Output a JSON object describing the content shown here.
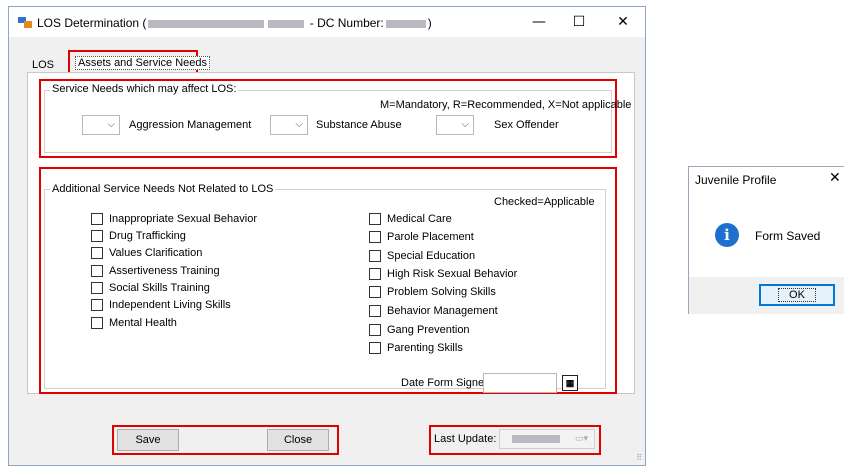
{
  "window": {
    "title_prefix": "LOS Determination (",
    "title_middle": "- DC Number:",
    "title_suffix": ")",
    "minimize": "—",
    "maximize": "☐",
    "close": "✕"
  },
  "tabs": {
    "los": "LOS",
    "assets": "Assets and Service Needs"
  },
  "service_needs": {
    "group_title": "Service Needs which may affect LOS:",
    "legend": "M=Mandatory, R=Recommended, X=Not applicable",
    "items": [
      "Aggression Management",
      "Substance Abuse",
      "Sex Offender"
    ]
  },
  "additional": {
    "group_title": "Additional Service Needs Not Related to LOS",
    "legend": "Checked=Applicable",
    "left": [
      "Inappropriate Sexual Behavior",
      "Drug Trafficking",
      "Values Clarification",
      "Assertiveness Training",
      "Social Skills Training",
      "Independent Living Skills",
      "Mental Health"
    ],
    "right": [
      "Medical Care",
      "Parole Placement",
      "Special Education",
      "High Risk Sexual Behavior",
      "Problem Solving Skills",
      "Behavior Management",
      "Gang Prevention",
      "Parenting Skills"
    ],
    "date_label": "Date Form Signed:",
    "date_value": ""
  },
  "footer": {
    "save": "Save",
    "close": "Close",
    "last_update_label": "Last Update:"
  },
  "dialog": {
    "title": "Juvenile Profile",
    "close": "✕",
    "icon": "i",
    "message": "Form Saved",
    "ok": "OK"
  }
}
